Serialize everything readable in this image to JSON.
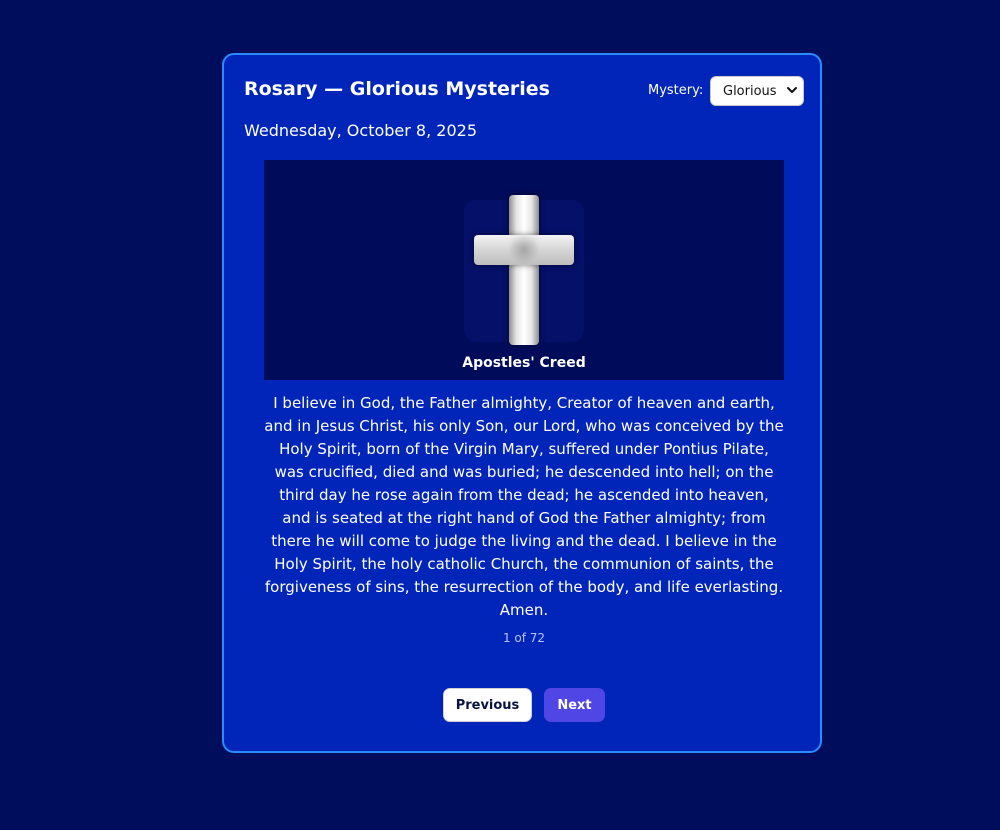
{
  "header": {
    "title": "Rosary — Glorious Mysteries",
    "mystery_label": "Mystery:",
    "mystery_selected": "Glorious"
  },
  "date": "Wednesday, October 8, 2025",
  "prayer": {
    "name": "Apostles' Creed",
    "image_icon": "cross-icon",
    "text": "I believe in God, the Father almighty, Creator of heaven and earth, and in Jesus Christ, his only Son, our Lord, who was conceived by the Holy Spirit, born of the Virgin Mary, suffered under Pontius Pilate, was crucified, died and was buried; he descended into hell; on the third day he rose again from the dead; he ascended into heaven, and is seated at the right hand of God the Father almighty; from there he will come to judge the living and the dead. I believe in the Holy Spirit, the holy catholic Church, the communion of saints, the forgiveness of sins, the resurrection of the body, and life everlasting. Amen."
  },
  "progress": {
    "label": "1 of 72"
  },
  "nav": {
    "previous_label": "Previous",
    "next_label": "Next"
  },
  "colors": {
    "page_background": "#000d5c",
    "card_background": "#0025b8",
    "card_border": "#2a8cff",
    "next_button": "#4f46e5"
  }
}
